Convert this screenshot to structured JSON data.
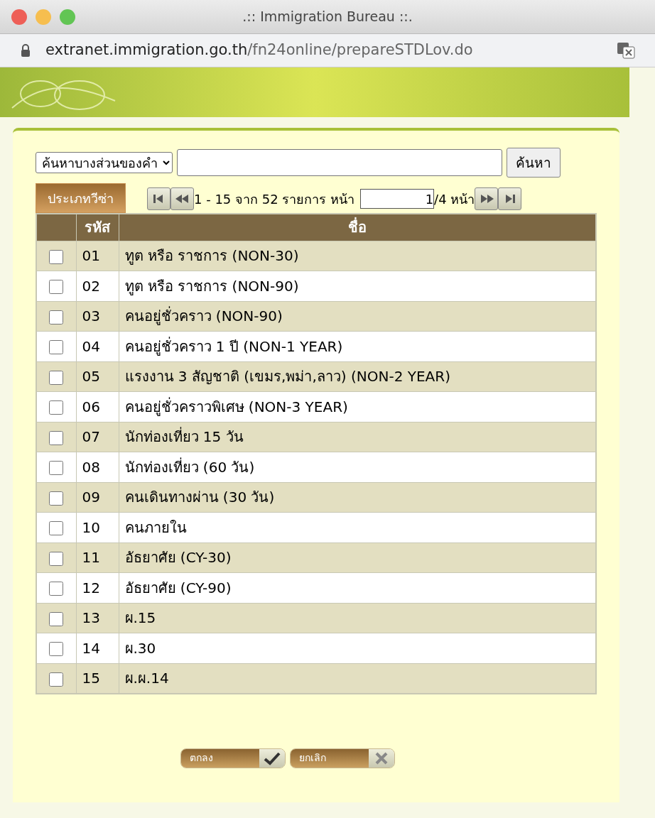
{
  "window": {
    "title": ".:: Immigration Bureau ::.",
    "url_host": "extranet.immigration.go.th",
    "url_path": "/fn24online/prepareSTDLov.do"
  },
  "search": {
    "mode": "ค้นหาบางส่วนของคำ",
    "button": "ค้นหา"
  },
  "tab": {
    "label": "ประเภทวีซ่า"
  },
  "pager": {
    "summary": "1 - 15 จาก 52 รายการ หน้า",
    "page": "1",
    "total": "/4 หน้า"
  },
  "table": {
    "columns": [
      "รหัส",
      "ชื่อ"
    ],
    "rows": [
      {
        "code": "01",
        "name": "ทูต หรือ ราชการ (NON-30)",
        "checked": false
      },
      {
        "code": "02",
        "name": "ทูต หรือ ราชการ (NON-90)",
        "checked": false
      },
      {
        "code": "03",
        "name": "คนอยู่ชั่วคราว (NON-90)",
        "checked": false
      },
      {
        "code": "04",
        "name": "คนอยู่ชั่วคราว 1 ปี (NON-1 YEAR)",
        "checked": false
      },
      {
        "code": "05",
        "name": "แรงงาน 3 สัญชาติ (เขมร,พม่า,ลาว) (NON-2 YEAR)",
        "checked": false
      },
      {
        "code": "06",
        "name": "คนอยู่ชั่วคราวพิเศษ (NON-3 YEAR)",
        "checked": false
      },
      {
        "code": "07",
        "name": "นักท่องเที่ยว 15 วัน",
        "checked": false
      },
      {
        "code": "08",
        "name": "นักท่องเที่ยว (60 วัน)",
        "checked": false
      },
      {
        "code": "09",
        "name": "คนเดินทางผ่าน (30 วัน)",
        "checked": false
      },
      {
        "code": "10",
        "name": "คนภายใน",
        "checked": false
      },
      {
        "code": "11",
        "name": "อัธยาศัย (CY-30)",
        "checked": false
      },
      {
        "code": "12",
        "name": "อัธยาศัย (CY-90)",
        "checked": false
      },
      {
        "code": "13",
        "name": "ผ.15",
        "checked": false
      },
      {
        "code": "14",
        "name": "ผ.30",
        "checked": false
      },
      {
        "code": "15",
        "name": "ผ.ผ.14",
        "checked": false
      }
    ]
  },
  "buttons": [
    {
      "label": "ตกลง",
      "kind": "ok"
    },
    {
      "label": "ยกเลิก",
      "kind": "cancel"
    }
  ]
}
